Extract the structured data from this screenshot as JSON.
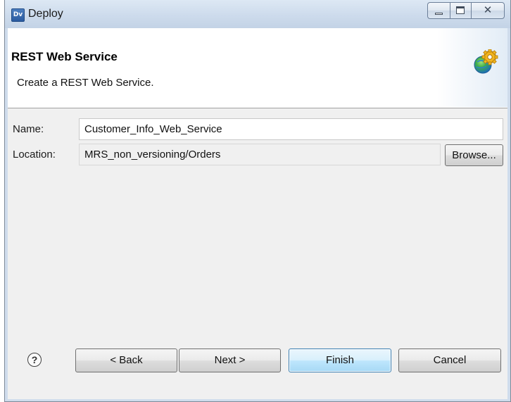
{
  "window": {
    "app_icon_text": "Dv",
    "title": "Deploy",
    "controls": {
      "minimize": "minimize",
      "maximize": "maximize",
      "close": "✕"
    }
  },
  "banner": {
    "title": "REST Web Service",
    "description": "Create a REST Web Service.",
    "icon": "globe-gear-icon"
  },
  "form": {
    "name_label": "Name:",
    "name_value": "Customer_Info_Web_Service",
    "location_label": "Location:",
    "location_value": "MRS_non_versioning/Orders",
    "browse_label": "Browse..."
  },
  "footer": {
    "help_symbol": "?",
    "back_label": "< Back",
    "next_label": "Next >",
    "finish_label": "Finish",
    "cancel_label": "Cancel"
  }
}
